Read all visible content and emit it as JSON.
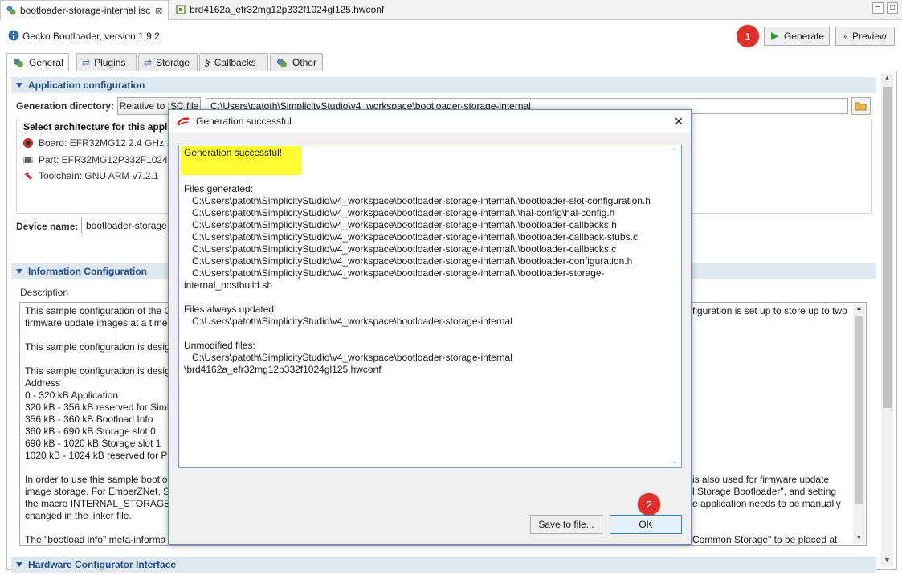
{
  "editor_tabs": [
    {
      "label": "bootloader-storage-internal.isc",
      "close": "⊠"
    },
    {
      "label": "brd4162a_efr32mg12p332f1024gl125.hwconf"
    }
  ],
  "window_buttons": {
    "minimize": "−",
    "maximize": "□"
  },
  "header": {
    "title": "Gecko Bootloader, version:1.9.2",
    "generate_label": "Generate",
    "preview_label": "Preview",
    "badge1": "1",
    "badge2": "2"
  },
  "inner_tabs": [
    "General",
    "Plugins",
    "Storage",
    "Callbacks",
    "Other"
  ],
  "app_config": {
    "section_title": "Application configuration",
    "gen_dir_label": "Generation directory:",
    "relative_button": "Relative to ISC file",
    "gen_dir_value": "C:\\Users\\patoth\\SimplicityStudio\\v4_workspace\\bootloader-storage-internal",
    "arch_label": "Select architecture for this appli",
    "board": "Board: EFR32MG12 2.4 GHz 10",
    "part": "Part: EFR32MG12P332F1024GL1",
    "toolchain": "Toolchain: GNU ARM v7.2.1",
    "device_name_label": "Device name:",
    "device_name_value": "bootloader-storage"
  },
  "info_config": {
    "section_title": "Information Configuration",
    "description_label": "Description",
    "left_lines": [
      "This sample configuration of the G",
      "firmware update images at a time,",
      "",
      "This sample configuration is desig",
      "",
      "This sample configuration is desig",
      "Address",
      "0 - 320 kB Application",
      "320 kB - 356 kB reserved for SimEE",
      "356 kB - 360 kB Bootload Info",
      "360 kB - 690 kB Storage slot 0",
      "690 kB - 1020 kB Storage slot 1",
      "1020 kB - 1024 kB reserved for PSto",
      "",
      "In order to use this sample bootlo",
      "image storage. For EmberZNet, Sil",
      "the macro INTERNAL_STORAGE_S",
      "changed in the linker file.",
      "",
      "The \"bootload info\" meta-informa"
    ],
    "right_lines": [
      {
        "row": 0,
        "text": "figuration is set up to store up to two"
      },
      {
        "row": 14,
        "text": "is also used for firmware update"
      },
      {
        "row": 15,
        "text": "l Storage Bootloader\", and setting"
      },
      {
        "row": 16,
        "text": "e application needs to be manually"
      },
      {
        "row": 19,
        "text": "Common Storage\" to be placed at"
      }
    ]
  },
  "hw_config": {
    "section_title": "Hardware Configurator Interface"
  },
  "dialog": {
    "title": "Generation successful",
    "close": "✕",
    "lines": [
      "Generation successful!",
      "",
      "",
      "Files generated:",
      "   C:\\Users\\patoth\\SimplicityStudio\\v4_workspace\\bootloader-storage-internal\\.\\bootloader-slot-configuration.h",
      "   C:\\Users\\patoth\\SimplicityStudio\\v4_workspace\\bootloader-storage-internal\\.\\hal-config\\hal-config.h",
      "   C:\\Users\\patoth\\SimplicityStudio\\v4_workspace\\bootloader-storage-internal\\.\\bootloader-callbacks.h",
      "   C:\\Users\\patoth\\SimplicityStudio\\v4_workspace\\bootloader-storage-internal\\.\\bootloader-callback-stubs.c",
      "   C:\\Users\\patoth\\SimplicityStudio\\v4_workspace\\bootloader-storage-internal\\.\\bootloader-callbacks.c",
      "   C:\\Users\\patoth\\SimplicityStudio\\v4_workspace\\bootloader-storage-internal\\.\\bootloader-configuration.h",
      "   C:\\Users\\patoth\\SimplicityStudio\\v4_workspace\\bootloader-storage-internal\\.\\bootloader-storage-",
      "internal_postbuild.sh",
      "",
      "Files always updated:",
      "   C:\\Users\\patoth\\SimplicityStudio\\v4_workspace\\bootloader-storage-internal",
      "",
      "Unmodified files:",
      "   C:\\Users\\patoth\\SimplicityStudio\\v4_workspace\\bootloader-storage-internal",
      "\\brd4162a_efr32mg12p332f1024gl125.hwconf"
    ],
    "save_button": "Save to file...",
    "ok_button": "OK"
  },
  "colors": {
    "badge": "#e0302b",
    "highlight": "#ffff33",
    "section_header": "#dfe8f1",
    "section_text": "#1a4d8f"
  }
}
